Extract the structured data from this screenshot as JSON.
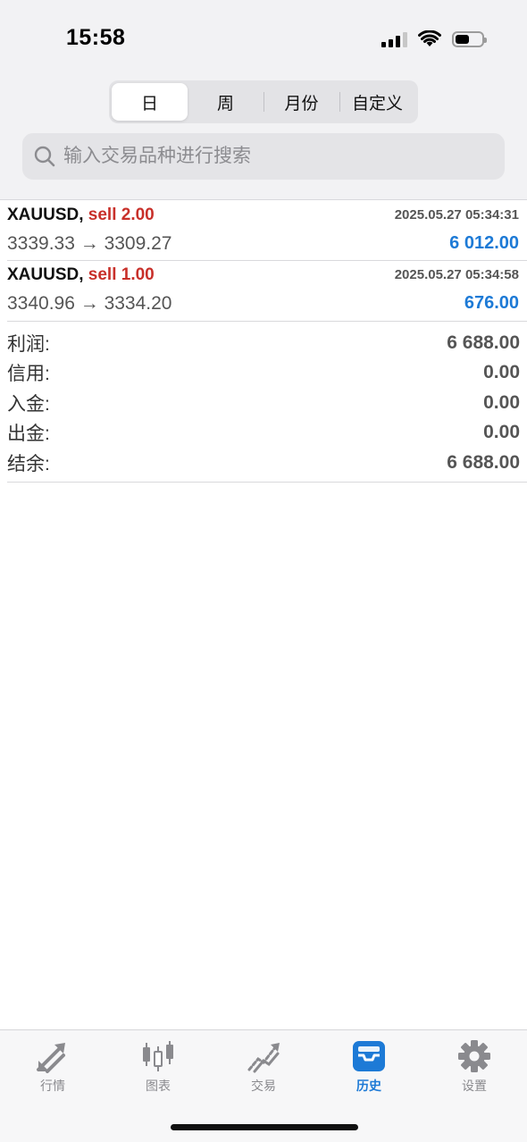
{
  "status_bar": {
    "time": "15:58"
  },
  "periods": [
    {
      "label": "日",
      "active": true
    },
    {
      "label": "周",
      "active": false
    },
    {
      "label": "月份",
      "active": false
    },
    {
      "label": "自定义",
      "active": false
    }
  ],
  "search": {
    "placeholder": "输入交易品种进行搜索"
  },
  "trades": [
    {
      "symbol": "XAUUSD,",
      "side": "sell 2.00",
      "time": "2025.05.27 05:34:31",
      "prices": "3339.33 → 3309.27",
      "profit": "6 012.00"
    },
    {
      "symbol": "XAUUSD,",
      "side": "sell 1.00",
      "time": "2025.05.27 05:34:58",
      "prices": "3340.96 → 3334.20",
      "profit": "676.00"
    }
  ],
  "summary": [
    {
      "label": "利润:",
      "value": "6 688.00"
    },
    {
      "label": "信用:",
      "value": "0.00"
    },
    {
      "label": "入金:",
      "value": "0.00"
    },
    {
      "label": "出金:",
      "value": "0.00"
    },
    {
      "label": "结余:",
      "value": "6 688.00"
    }
  ],
  "tabs": [
    {
      "label": "行情",
      "icon": "quotes-arrows-icon",
      "active": false
    },
    {
      "label": "图表",
      "icon": "candlestick-icon",
      "active": false
    },
    {
      "label": "交易",
      "icon": "trade-trend-icon",
      "active": false
    },
    {
      "label": "历史",
      "icon": "history-inbox-icon",
      "active": true
    },
    {
      "label": "设置",
      "icon": "gear-icon",
      "active": false
    }
  ],
  "colors": {
    "accent_blue": "#1d7ad6",
    "sell_red": "#c8302a",
    "inactive_gray": "#8a8a8e"
  }
}
